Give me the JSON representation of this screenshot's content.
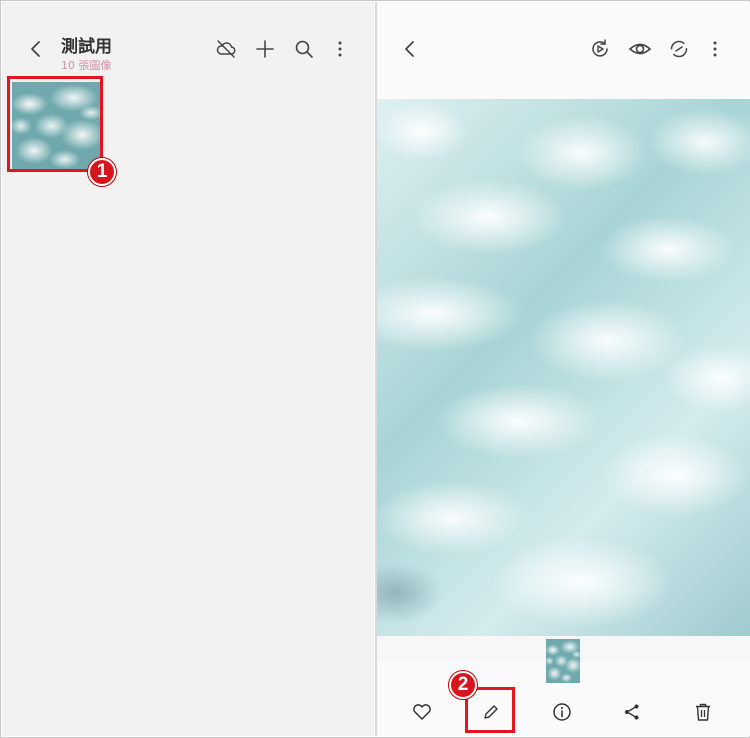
{
  "album": {
    "title": "測試用",
    "subtitle": "10 張圖像"
  },
  "left_header_icons": [
    "back-icon",
    "cloud-off-icon",
    "plus-icon",
    "search-icon",
    "more-vertical-icon"
  ],
  "right_header_icons": [
    "back-icon",
    "motion-play-icon",
    "eye-icon",
    "sync-icon",
    "more-vertical-icon"
  ],
  "bottom_toolbar_icons": [
    "heart-icon",
    "pencil-icon",
    "info-icon",
    "share-icon",
    "trash-icon"
  ],
  "callouts": [
    {
      "number": "1",
      "target": "album-thumbnail"
    },
    {
      "number": "2",
      "target": "edit-button"
    }
  ],
  "colors": {
    "callout_red": "#e3161f",
    "subtitle_pink": "#d48ea0",
    "left_background": "#f2f2f2",
    "right_background": "#fafafa"
  }
}
